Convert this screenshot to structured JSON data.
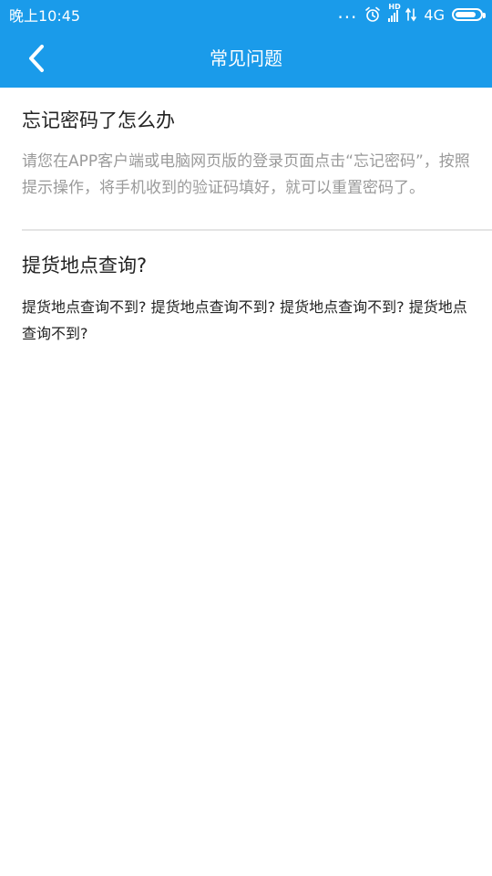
{
  "status_bar": {
    "time": "晚上10:45",
    "dots": "...",
    "signal_tag": "HD",
    "network": "4G",
    "battery_level": 0.85,
    "color": "#1a9bea"
  },
  "header": {
    "title": "常见问题",
    "back_icon": "chevron-left-icon",
    "background_color": "#1a9bea"
  },
  "faq": [
    {
      "question": "忘记密码了怎么办",
      "answer": "请您在APP客户端或电脑网页版的登录页面点击“忘记密码”，按照提示操作，将手机收到的验证码填好，就可以重置密码了。"
    },
    {
      "question": "提货地点查询?",
      "answer": "提货地点查询不到? 提货地点查询不到? 提货地点查询不到? 提货地点查询不到?"
    }
  ]
}
